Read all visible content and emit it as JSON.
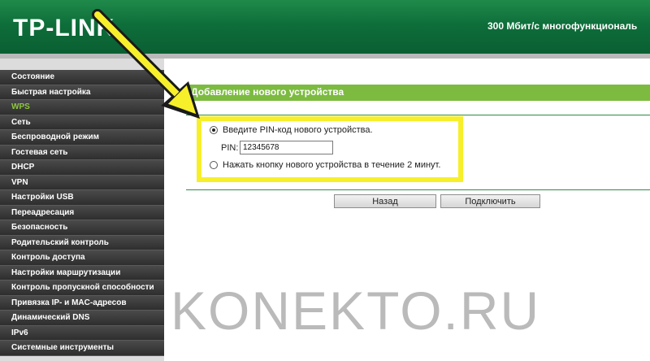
{
  "header": {
    "logo": "TP-LINK",
    "product": "300 Мбит/с многофункциональ"
  },
  "sidebar": {
    "items": [
      {
        "label": "Состояние",
        "active": false
      },
      {
        "label": "Быстрая настройка",
        "active": false
      },
      {
        "label": "WPS",
        "active": true
      },
      {
        "label": "Сеть",
        "active": false
      },
      {
        "label": "Беспроводной режим",
        "active": false
      },
      {
        "label": "Гостевая сеть",
        "active": false
      },
      {
        "label": "DHCP",
        "active": false
      },
      {
        "label": "VPN",
        "active": false
      },
      {
        "label": "Настройки USB",
        "active": false
      },
      {
        "label": "Переадресация",
        "active": false
      },
      {
        "label": "Безопасность",
        "active": false
      },
      {
        "label": "Родительский контроль",
        "active": false
      },
      {
        "label": "Контроль доступа",
        "active": false
      },
      {
        "label": "Настройки маршрутизации",
        "active": false
      },
      {
        "label": "Контроль пропускной способности",
        "active": false
      },
      {
        "label": "Привязка IP- и MAC-адресов",
        "active": false
      },
      {
        "label": "Динамический DNS",
        "active": false
      },
      {
        "label": "IPv6",
        "active": false
      },
      {
        "label": "Системные инструменты",
        "active": false
      }
    ]
  },
  "main": {
    "section_title": "Добавление нового устройства",
    "option_pin": "Введите PIN-код нового устройства.",
    "pin_label": "PIN:",
    "pin_value": "12345678",
    "option_button": "Нажать кнопку нового устройства в течение 2 минут.",
    "back_label": "Назад",
    "connect_label": "Подключить"
  },
  "watermark": "KONEKTO.RU",
  "colors": {
    "header": "#0e6e3a",
    "section_bar": "#7cbb40",
    "highlight": "#f7ef2a",
    "sidebar_active_text": "#8ec63f"
  },
  "icons": [
    "arrow-annotation-icon",
    "radio-icon"
  ]
}
